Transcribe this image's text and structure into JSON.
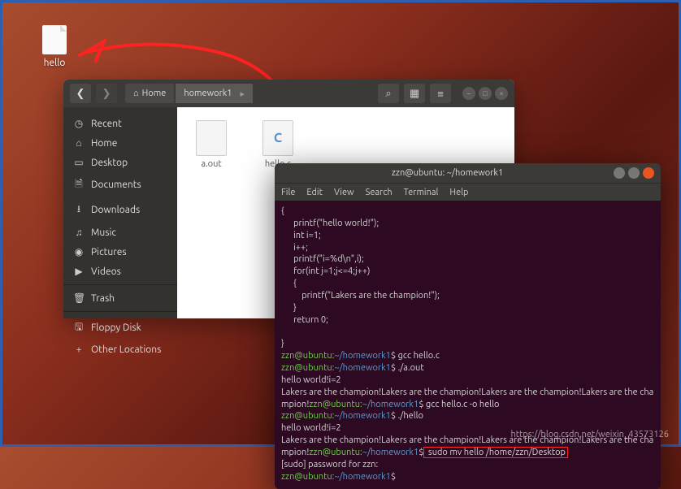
{
  "desktop": {
    "icon_label": "hello"
  },
  "files": {
    "path": {
      "home": "Home",
      "folder": "homework1"
    },
    "sidebar": [
      {
        "icon": "◷",
        "label": "Recent"
      },
      {
        "icon": "⌂",
        "label": "Home"
      },
      {
        "icon": "▭",
        "label": "Desktop"
      },
      {
        "icon": "🗎",
        "label": "Documents"
      },
      {
        "icon": "⭳",
        "label": "Downloads"
      },
      {
        "icon": "♫",
        "label": "Music"
      },
      {
        "icon": "◉",
        "label": "Pictures"
      },
      {
        "icon": "▶",
        "label": "Videos"
      },
      {
        "icon": "🗑",
        "label": "Trash"
      },
      {
        "icon": "🖫",
        "label": "Floppy Disk"
      },
      {
        "icon": "+",
        "label": "Other Locations"
      }
    ],
    "items": [
      {
        "name": "a.out",
        "type": "plain"
      },
      {
        "name": "hello.c",
        "type": "c"
      }
    ]
  },
  "terminal": {
    "title": "zzn@ubuntu: ~/homework1",
    "menu": [
      "File",
      "Edit",
      "View",
      "Search",
      "Terminal",
      "Help"
    ]
  },
  "code": {
    "l0": "{",
    "l1": "      printf(\"hello world!\");",
    "l2": "      int i=1;",
    "l3": "      i++;",
    "l4": "      printf(\"i=%d\\n\",i);",
    "l5": "      for(int j=1;j<=4;j++)",
    "l6": "      {",
    "l7": "          printf(\"Lakers are the champion!\");",
    "l8": "      }",
    "l9": "      return 0;",
    "l10": "",
    "l11": "}"
  },
  "out": {
    "prompt_user": "zzn@ubuntu",
    "prompt_path": "~/homework1",
    "cmd1": " gcc hello.c",
    "cmd2": " ./a.out",
    "line1": "hello world!i=2",
    "line2": "Lakers are the champion!Lakers are the champion!Lakers are the champion!Lakers are the champion!",
    "cmd3": " gcc hello.c -o hello",
    "cmd4": " ./hello",
    "cmd5": " sudo mv hello /home/zzn/Desktop",
    "sudo": "[sudo] password for zzn:"
  },
  "watermark": "https://blog.csdn.net/weixin_43573126"
}
